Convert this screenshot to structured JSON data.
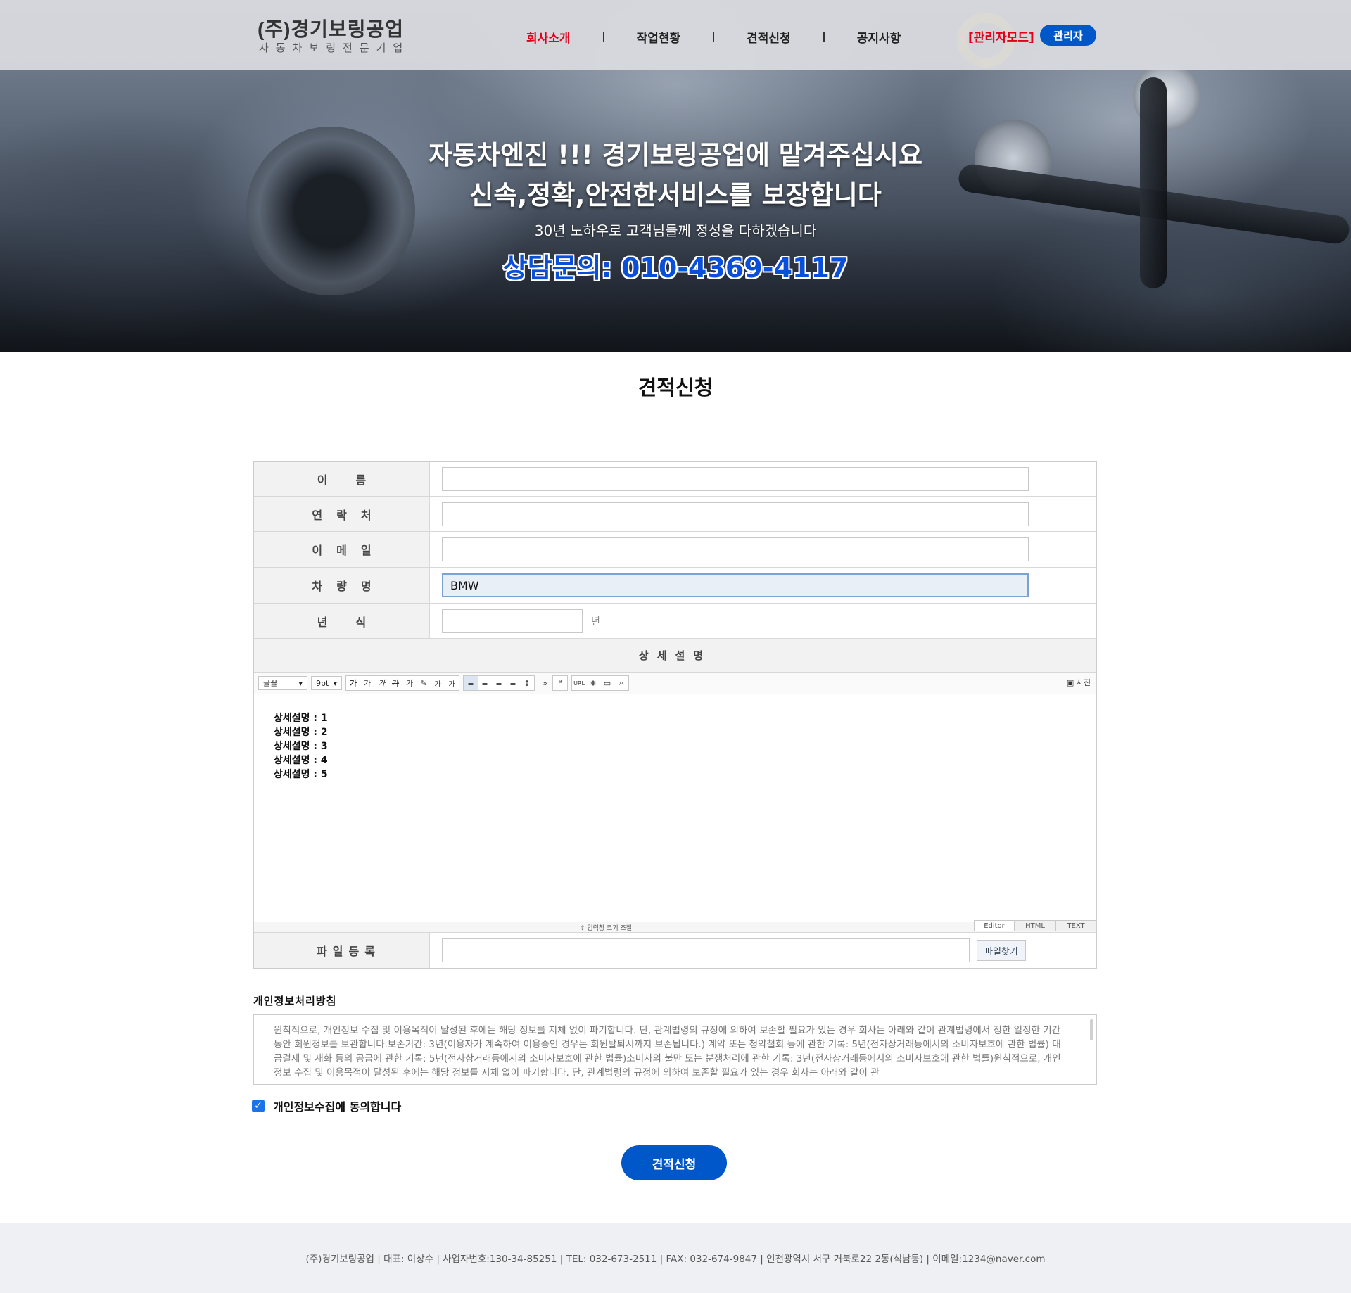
{
  "header": {
    "logo_main": "(주)경기보링공업",
    "logo_sub": "자동차보링전문기업",
    "nav": [
      "회사소개",
      "작업현황",
      "견적신청",
      "공지사항"
    ],
    "admin_mode": "[관리자모드]",
    "admin_button": "관리자"
  },
  "hero": {
    "line1": "자동차엔진 !!! 경기보링공업에 맡겨주십시요",
    "line2": "신속,정확,안전한서비스를 보장합니다",
    "line3": "30년 노하우로 고객님들께 정성을 다하겠습니다",
    "phone": "상담문의: 010-4369-4117"
  },
  "page_title": "견적신청",
  "form": {
    "labels": {
      "name": "이름",
      "contact": "연락처",
      "email": "이메일",
      "car": "차량명",
      "year": "년식",
      "detail": "상세설명",
      "file": "파일등록"
    },
    "values": {
      "name": "",
      "contact": "",
      "email": "",
      "car": "BMW",
      "year": ""
    },
    "year_unit": "년",
    "toolbar": {
      "font": "글꼴",
      "size": "9pt",
      "photo": "사진",
      "buttons": [
        "가",
        "가",
        "가",
        "가",
        "가",
        "가",
        "가",
        "가"
      ]
    },
    "editor_lines": [
      "상세설명 : 1",
      "상세설명 : 2",
      "상세설명 : 3",
      "상세설명 : 4",
      "상세설명 : 5"
    ],
    "resize_label": "입력창 크기 조절",
    "modes": [
      "Editor",
      "HTML",
      "TEXT"
    ],
    "file_button": "파일찾기"
  },
  "privacy": {
    "title": "개인정보처리방침",
    "text": "원칙적으로, 개인정보 수집 및 이용목적이 달성된 후에는 해당 정보를 지체 없이 파기합니다. 단, 관계법령의 규정에 의하여 보존할 필요가 있는 경우 회사는 아래와 같이 관계법령에서 정한 일정한 기간동안 회원정보를 보관합니다.보존기간: 3년(이용자가 계속하여 이용중인 경우는 회원탈퇴시까지 보존됩니다.) 계약 또는 청약철회 등에 관한 기록: 5년(전자상거래등에서의 소비자보호에 관한 법률) 대금결제 및 재화 등의 공급에 관한 기록: 5년(전자상거래등에서의 소비자보호에 관한 법률)소비자의 불만 또는 분쟁처리에 관한 기록: 3년(전자상거래등에서의 소비자보호에 관한 법률)원칙적으로, 개인정보 수집 및 이용목적이 달성된 후에는 해당 정보를 지체 없이 파기합니다. 단, 관계법령의 규정에 의하여 보존할 필요가 있는 경우 회사는 아래와 같이 관",
    "agree_label": "개인정보수집에 동의합니다",
    "agree_checked": true
  },
  "submit_label": "견적신청",
  "footer": "(주)경기보링공업   |  대표: 이상수  |  사업자번호:130-34-85251  |  TEL: 032-673-2511  |  FAX: 032-674-9847  |  인천광역시 서구 거북로22 2동(석남동)   |  이메일:1234@naver.com",
  "colors": {
    "accent_blue": "#0057c9",
    "nav_active_red": "#e0001b",
    "phone_blue": "#0a4fd9"
  }
}
